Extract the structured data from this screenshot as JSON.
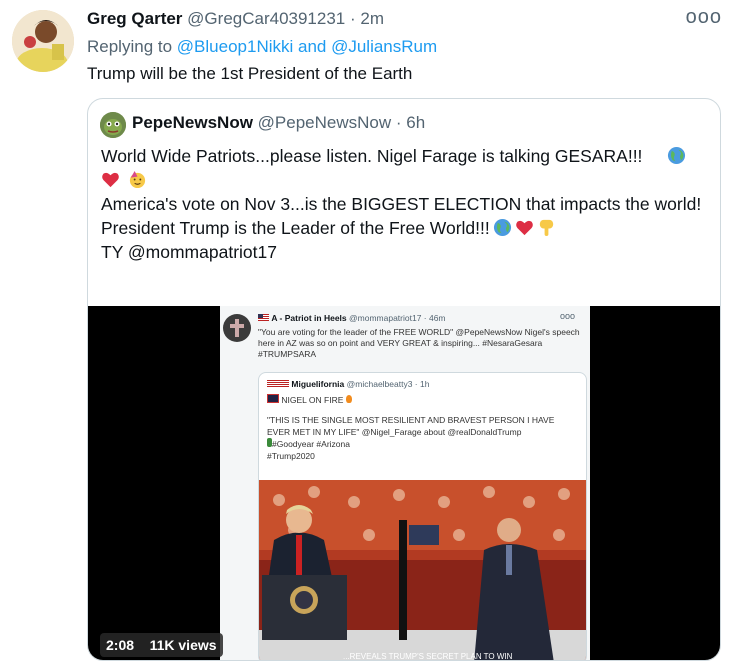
{
  "tweet": {
    "author_name": "Greg Qarter",
    "author_handle": "@GregCar40391231",
    "separator": "·",
    "time": "2m",
    "more_label": "ooo",
    "reply_prefix": "Replying to",
    "reply_to": "@Blueop1Nikki and @JuliansRum",
    "text": "Trump will be the 1st President of the Earth"
  },
  "quote": {
    "author_name": "PepeNewsNow",
    "author_handle": "@PepeNewsNow",
    "separator": "·",
    "time": "6h",
    "line1": "World Wide Patriots...please listen.  Nigel Farage is talking GESARA!!!",
    "line3": "America's vote on Nov 3...is the BIGGEST ELECTION that impacts the world!",
    "line4": "President Trump is the Leader of the Free World!!!",
    "line5": "TY @mommapatriot17"
  },
  "video": {
    "duration": "2:08",
    "views": "11K views",
    "inner_author": "A - Patriot in Heels",
    "inner_handle": "@mommapatriot17 · 46m",
    "inner_more": "ooo",
    "inner_text": "\"You are voting for the leader of the FREE WORLD\" @PepeNewsNow Nigel's speech here in AZ was so on point and VERY GREAT & inspiring... #NesaraGesara #TRUMPSARA",
    "card_author": "Miguelifornia",
    "card_handle": "@michaelbeatty3 · 1h",
    "card_line1": "NIGEL ON FIRE",
    "card_line2": "\"THIS IS THE SINGLE MOST RESILIENT AND BRAVEST  PERSON I HAVE EVER MET IN MY LIFE\" @Nigel_Farage about @realDonaldTrump",
    "card_line3": "#Goodyear #Arizona",
    "card_line4": "#Trump2020",
    "banner_text": "...REVEALS TRUMP'S SECRET PLAN TO WIN"
  },
  "icons": [
    "avatar",
    "globe-icon",
    "heart-icon",
    "party-face-icon",
    "pointing-down-icon",
    "us-flag-icon",
    "uk-flag-icon",
    "fire-icon",
    "cactus-icon",
    "cross-avatar-icon"
  ],
  "colors": {
    "link": "#1d9bf0",
    "muted": "#536471",
    "border": "#cfd9de"
  }
}
